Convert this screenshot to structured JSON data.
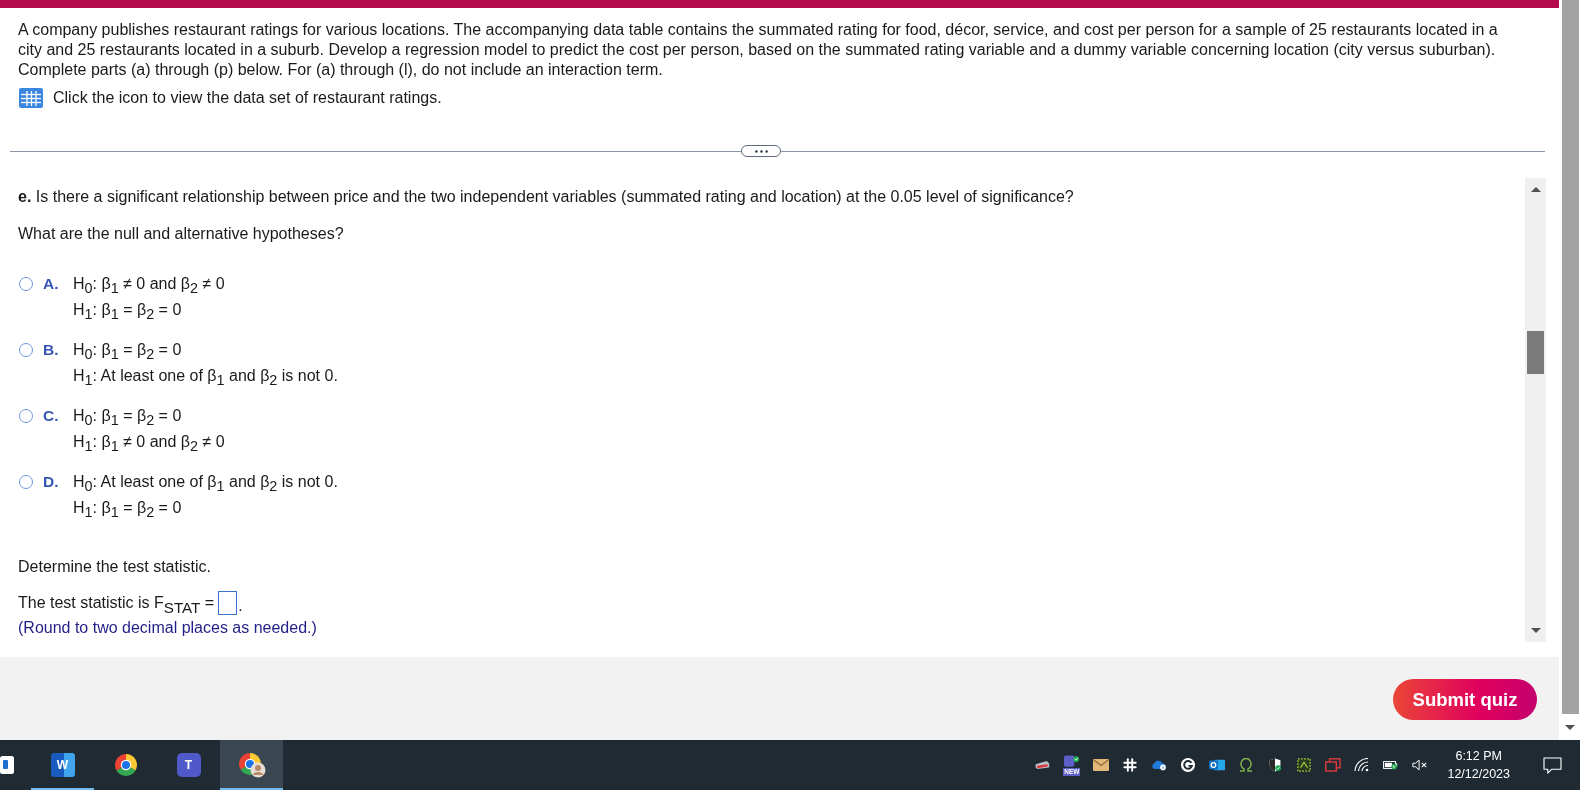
{
  "header": {
    "intro": "A company publishes restaurant ratings for various locations. The accompanying data table contains the summated rating for food, décor, service, and cost per person for a sample of 25 restaurants located in a city and 25 restaurants located in a suburb. Develop a regression model to predict the cost per person, based on the summated rating variable and a dummy variable concerning location (city versus suburban). Complete parts (a) through (p) below. For (a) through (l), do not include an interaction term.",
    "data_link": "Click the icon to view the data set of restaurant ratings."
  },
  "question": {
    "prompt": "**e.** Is there a significant relationship between price and the two independent variables (summated rating and location) at the 0.05 level of significance?",
    "hypotheses_prompt": "What are the null and alternative hypotheses?",
    "options": [
      {
        "letter": "A.",
        "selected": false,
        "lines": [
          "H$_{0}$: β$_{1}$ ≠ 0 and β$_{2}$ ≠ 0",
          "H$_{1}$: β$_{1}$ = β$_{2}$ = 0"
        ]
      },
      {
        "letter": "B.",
        "selected": false,
        "lines": [
          "H$_{0}$: β$_{1}$ = β$_{2}$ = 0",
          "H$_{1}$: At least one of β$_{1}$ and β$_{2}$ is not 0."
        ]
      },
      {
        "letter": "C.",
        "selected": false,
        "lines": [
          "H$_{0}$: β$_{1}$ = β$_{2}$ = 0",
          "H$_{1}$: β$_{1}$ ≠ 0 and β$_{2}$ ≠ 0"
        ]
      },
      {
        "letter": "D.",
        "selected": false,
        "lines": [
          "H$_{0}$: At least one of β$_{1}$ and β$_{2}$ is not 0.",
          "H$_{1}$: β$_{1}$ = β$_{2}$ = 0"
        ]
      }
    ],
    "statistic_prompt": "Determine the test statistic.",
    "statistic_lead": "The test statistic is F$_{STAT}$ =",
    "statistic_end": ".",
    "rounding_note": "(Round to two decimal places as needed.)"
  },
  "footer": {
    "submit": "Submit quiz"
  },
  "taskbar": {
    "apps": [
      {
        "kind": "tile",
        "running": false,
        "selected": false
      },
      {
        "kind": "word",
        "glyph": "W",
        "running": true,
        "selected": false
      },
      {
        "kind": "browser",
        "running": false,
        "selected": false
      },
      {
        "kind": "teams",
        "glyph": "T",
        "running": false,
        "selected": false
      },
      {
        "kind": "profile",
        "running": true,
        "selected": true
      }
    ],
    "tray_badge": "NEW",
    "time": "6:12 PM",
    "date": "12/12/2023"
  }
}
